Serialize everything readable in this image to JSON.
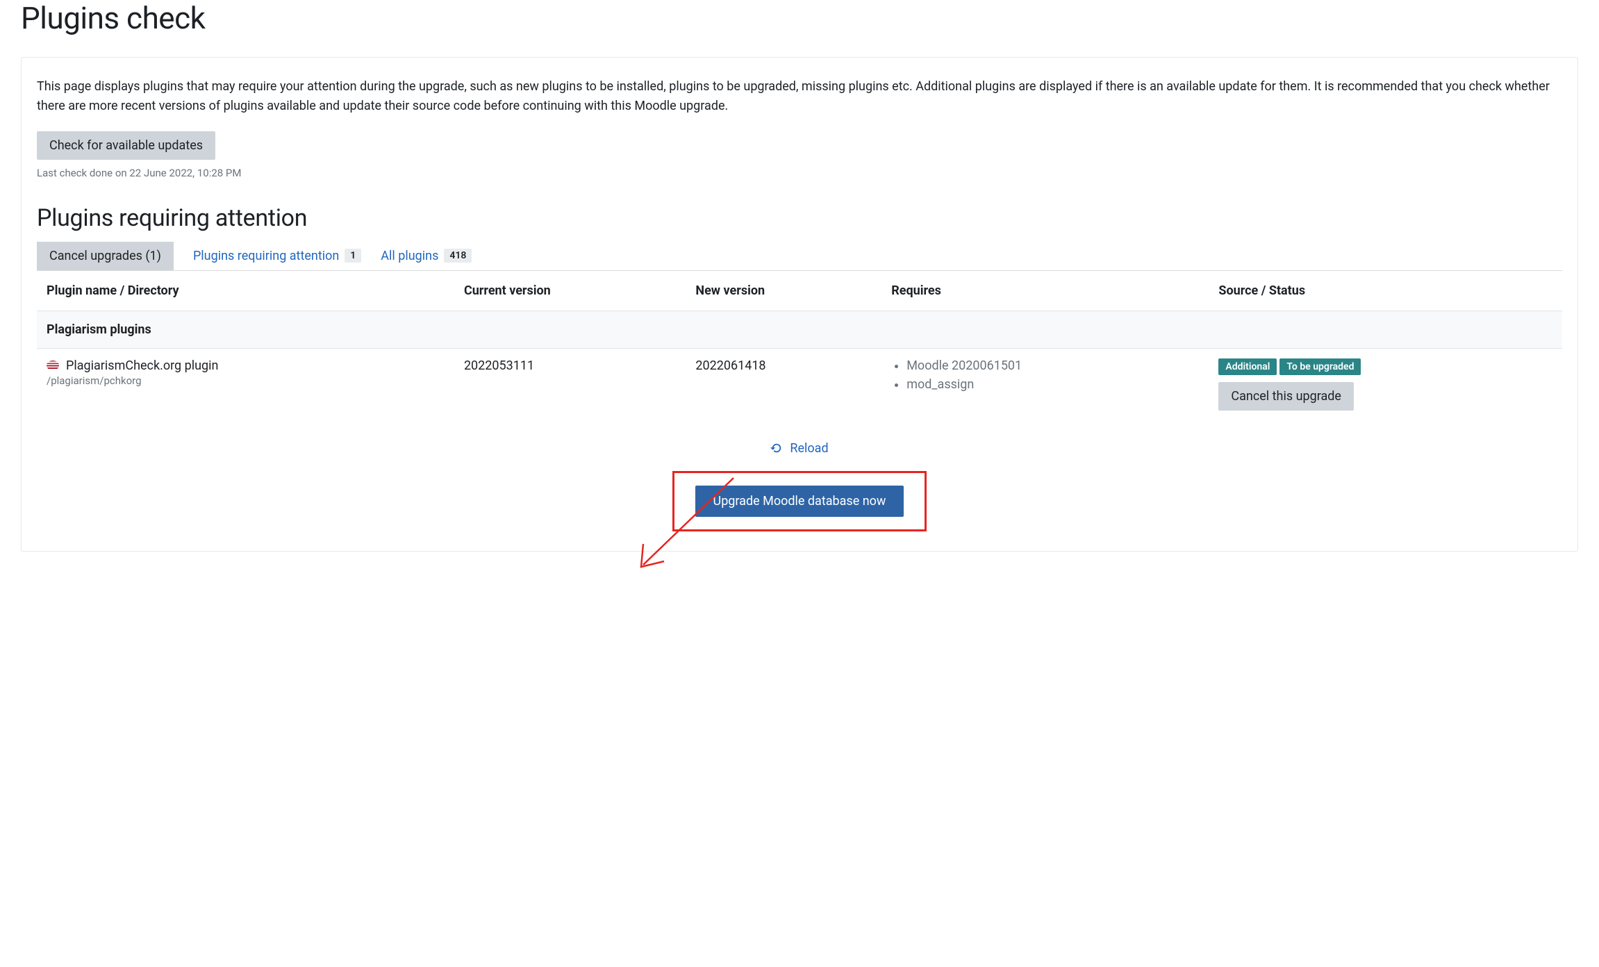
{
  "page": {
    "title": "Plugins check",
    "intro": "This page displays plugins that may require your attention during the upgrade, such as new plugins to be installed, plugins to be upgraded, missing plugins etc. Additional plugins are displayed if there is an available update for them. It is recommended that you check whether there are more recent versions of plugins available and update their source code before continuing with this Moodle upgrade.",
    "check_updates_label": "Check for available updates",
    "last_check": "Last check done on 22 June 2022, 10:28 PM",
    "section_title": "Plugins requiring attention"
  },
  "filters": {
    "cancel_upgrades_label": "Cancel upgrades (1)",
    "requiring_attention_label": "Plugins requiring attention",
    "requiring_attention_count": "1",
    "all_plugins_label": "All plugins",
    "all_plugins_count": "418"
  },
  "table": {
    "headers": {
      "name": "Plugin name / Directory",
      "current": "Current version",
      "new": "New version",
      "requires": "Requires",
      "status": "Source / Status"
    },
    "category": "Plagiarism plugins",
    "row": {
      "name": "PlagiarismCheck.org plugin",
      "directory": "/plagiarism/pchkorg",
      "current_version": "2022053111",
      "new_version": "2022061418",
      "requires": [
        "Moodle 2020061501",
        "mod_assign"
      ],
      "badges": [
        "Additional",
        "To be upgraded"
      ],
      "cancel_label": "Cancel this upgrade"
    }
  },
  "footer": {
    "reload_label": "Reload",
    "upgrade_label": "Upgrade Moodle database now"
  }
}
